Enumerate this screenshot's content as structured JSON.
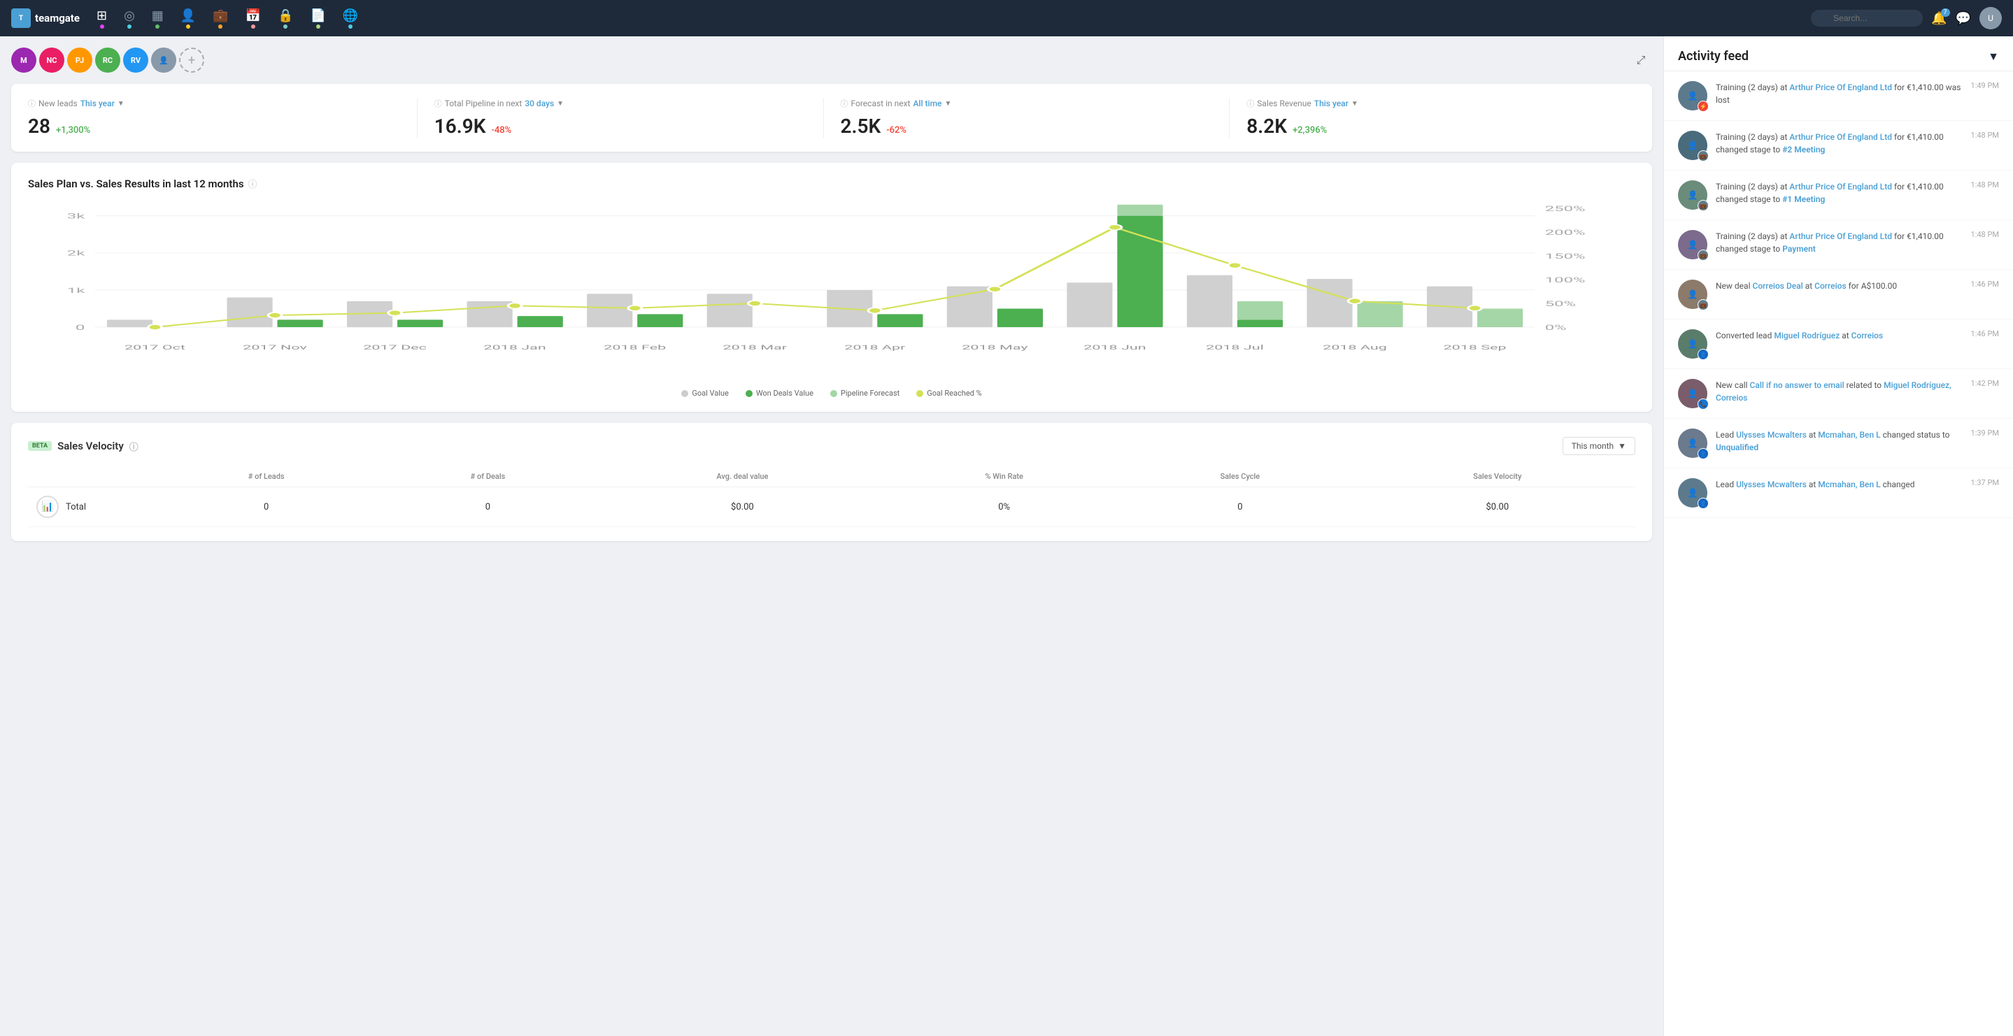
{
  "logo": {
    "text": "teamgate",
    "icon": "T"
  },
  "nav": {
    "items": [
      {
        "name": "dashboard",
        "icon": "⊞",
        "dot_color": "#e040fb",
        "active": true
      },
      {
        "name": "targets",
        "icon": "◎",
        "dot_color": "#4dd0e1"
      },
      {
        "name": "reports",
        "icon": "▦",
        "dot_color": "#66bb6a"
      },
      {
        "name": "contacts",
        "icon": "👤",
        "dot_color": "#ffca28"
      },
      {
        "name": "deals",
        "icon": "💼",
        "dot_color": "#ffa726"
      },
      {
        "name": "calendar",
        "icon": "📅",
        "dot_color": "#ef9a9a"
      },
      {
        "name": "security",
        "icon": "🔒",
        "dot_color": "#80cbc4"
      },
      {
        "name": "documents",
        "icon": "📄",
        "dot_color": "#aed581"
      },
      {
        "name": "global",
        "icon": "🌐",
        "dot_color": "#4dd0e1"
      }
    ]
  },
  "search": {
    "placeholder": "Search..."
  },
  "avatars": [
    {
      "initials": "M",
      "color": "#9c27b0",
      "label": "M"
    },
    {
      "initials": "NC",
      "color": "#e91e63",
      "label": "NC"
    },
    {
      "initials": "PJ",
      "color": "#ff9800",
      "label": "PJ"
    },
    {
      "initials": "RC",
      "color": "#4caf50",
      "label": "RC"
    },
    {
      "initials": "RV",
      "color": "#2196f3",
      "label": "RV"
    }
  ],
  "kpis": [
    {
      "label": "New leads",
      "period": "This year",
      "value": "28",
      "change": "+1,300%",
      "change_type": "positive"
    },
    {
      "label": "Total Pipeline in next",
      "period": "30 days",
      "value": "16.9K",
      "change": "-48%",
      "change_type": "negative"
    },
    {
      "label": "Forecast in next",
      "period": "All time",
      "value": "2.5K",
      "change": "-62%",
      "change_type": "negative"
    },
    {
      "label": "Sales Revenue",
      "period": "This year",
      "value": "8.2K",
      "change": "+2,396%",
      "change_type": "positive"
    }
  ],
  "chart": {
    "title": "Sales Plan vs. Sales Results in last 12 months",
    "legend": [
      {
        "type": "dot",
        "color": "#ccc",
        "label": "Goal Value"
      },
      {
        "type": "dot",
        "color": "#4caf50",
        "label": "Won Deals Value"
      },
      {
        "type": "dot",
        "color": "#a5d6a7",
        "label": "Pipeline Forecast"
      },
      {
        "type": "dot",
        "color": "#d4e157",
        "label": "Goal Reached %"
      }
    ],
    "months": [
      "2017 Oct",
      "2017 Nov",
      "2017 Dec",
      "2018 Jan",
      "2018 Feb",
      "2018 Mar",
      "2018 Apr",
      "2018 May",
      "2018 Jun",
      "2018 Jul",
      "2018 Aug",
      "2018 Sep"
    ],
    "goal_values": [
      200,
      800,
      700,
      700,
      900,
      900,
      1000,
      1100,
      1200,
      1400,
      1300,
      1100
    ],
    "won_values": [
      0,
      200,
      200,
      300,
      350,
      0,
      350,
      500,
      3000,
      200,
      0,
      0
    ],
    "pipeline": [
      0,
      0,
      0,
      0,
      0,
      0,
      0,
      0,
      300,
      500,
      700,
      500
    ],
    "goal_pct": [
      0,
      25,
      30,
      45,
      40,
      50,
      35,
      80,
      210,
      130,
      55,
      40
    ]
  },
  "velocity": {
    "title": "Sales Velocity",
    "beta_label": "BETA",
    "period": "This month",
    "columns": [
      "# of Leads",
      "# of Deals",
      "Avg. deal value",
      "% Win Rate",
      "Sales Cycle",
      "Sales Velocity"
    ],
    "rows": [
      {
        "icon": "📊",
        "label": "Total",
        "leads": "0",
        "deals": "0",
        "avg_deal": "$0.00",
        "win_rate": "0%",
        "cycle": "0",
        "velocity": "$0.00"
      }
    ]
  },
  "activity_feed": {
    "title": "Activity feed",
    "items": [
      {
        "badge_color": "#f44336",
        "badge_icon": "⚡",
        "text_parts": [
          {
            "type": "text",
            "content": "Training (2 days) at "
          },
          {
            "type": "link",
            "content": "Arthur Price Of England Ltd"
          },
          {
            "type": "text",
            "content": " for €1,410.00 was lost"
          }
        ],
        "time": "1:49 PM",
        "full_text": "Training (2 days) at Arthur Price Of England Ltd for €1,410.00 was lost"
      },
      {
        "badge_color": "#607d8b",
        "badge_icon": "💼",
        "text_parts": [
          {
            "type": "text",
            "content": "Training (2 days) at "
          },
          {
            "type": "link",
            "content": "Arthur Price Of England Ltd"
          },
          {
            "type": "text",
            "content": " for €1,410.00 changed stage to "
          },
          {
            "type": "link_bold",
            "content": "#2 Meeting"
          }
        ],
        "time": "1:48 PM",
        "full_text": "Training (2 days) at Arthur Price Of England Ltd for €1,410.00 changed stage to #2 Meeting"
      },
      {
        "badge_color": "#607d8b",
        "badge_icon": "💼",
        "text_parts": [
          {
            "type": "text",
            "content": "Training (2 days) at "
          },
          {
            "type": "link",
            "content": "Arthur Price Of England Ltd"
          },
          {
            "type": "text",
            "content": " for €1,410.00 changed stage to "
          },
          {
            "type": "link_bold",
            "content": "#1 Meeting"
          }
        ],
        "time": "1:48 PM",
        "full_text": "Training (2 days) at Arthur Price Of England Ltd for €1,410.00 changed stage to #1 Meeting"
      },
      {
        "badge_color": "#607d8b",
        "badge_icon": "💼",
        "text_parts": [
          {
            "type": "text",
            "content": "Training (2 days) at "
          },
          {
            "type": "link",
            "content": "Arthur Price Of England Ltd"
          },
          {
            "type": "text",
            "content": " for €1,410.00 changed stage to "
          },
          {
            "type": "link_bold",
            "content": "Payment"
          }
        ],
        "time": "1:48 PM",
        "full_text": "Training (2 days) at Arthur Price Of England Ltd for €1,410.00 changed stage to Payment"
      },
      {
        "badge_color": "#607d8b",
        "badge_icon": "💼",
        "text_parts": [
          {
            "type": "text",
            "content": "New deal "
          },
          {
            "type": "link",
            "content": "Correios Deal"
          },
          {
            "type": "text",
            "content": " at "
          },
          {
            "type": "link",
            "content": "Correios"
          },
          {
            "type": "text",
            "content": " for A$100.00"
          }
        ],
        "time": "1:46 PM",
        "full_text": "New deal Correios Deal at Correios for A$100.00"
      },
      {
        "badge_color": "#1565c0",
        "badge_icon": "👤",
        "text_parts": [
          {
            "type": "text",
            "content": "Converted lead "
          },
          {
            "type": "link",
            "content": "Miguel Rodríguez"
          },
          {
            "type": "text",
            "content": " at "
          },
          {
            "type": "link",
            "content": "Correios"
          }
        ],
        "time": "1:46 PM",
        "full_text": "Converted lead Miguel Rodríguez at Correios"
      },
      {
        "badge_color": "#1976d2",
        "badge_icon": "📞",
        "text_parts": [
          {
            "type": "text",
            "content": "New call "
          },
          {
            "type": "link",
            "content": "Call if no answer to email"
          },
          {
            "type": "text",
            "content": " related to "
          },
          {
            "type": "link",
            "content": "Miguel Rodríguez, Correios"
          }
        ],
        "time": "1:42 PM",
        "full_text": "New call Call if no answer to email related to Miguel Rodríguez, Correios"
      },
      {
        "badge_color": "#1565c0",
        "badge_icon": "👤",
        "text_parts": [
          {
            "type": "text",
            "content": "Lead "
          },
          {
            "type": "link",
            "content": "Ulysses Mcwalters"
          },
          {
            "type": "text",
            "content": " at "
          },
          {
            "type": "link",
            "content": "Mcmahan, Ben L"
          },
          {
            "type": "text",
            "content": " changed status to "
          },
          {
            "type": "link_bold",
            "content": "Unqualified"
          }
        ],
        "time": "1:39 PM",
        "full_text": "Lead Ulysses Mcwalters at Mcmahan, Ben L changed status to Unqualified"
      },
      {
        "badge_color": "#1565c0",
        "badge_icon": "👤",
        "text_parts": [
          {
            "type": "text",
            "content": "Lead "
          },
          {
            "type": "link",
            "content": "Ulysses Mcwalters"
          },
          {
            "type": "text",
            "content": " at "
          },
          {
            "type": "link",
            "content": "Mcmahan, Ben L"
          },
          {
            "type": "text",
            "content": " changed"
          }
        ],
        "time": "1:37 PM",
        "full_text": "Lead Ulysses Mcwalters at Mcmahan, Ben L changed"
      }
    ]
  }
}
